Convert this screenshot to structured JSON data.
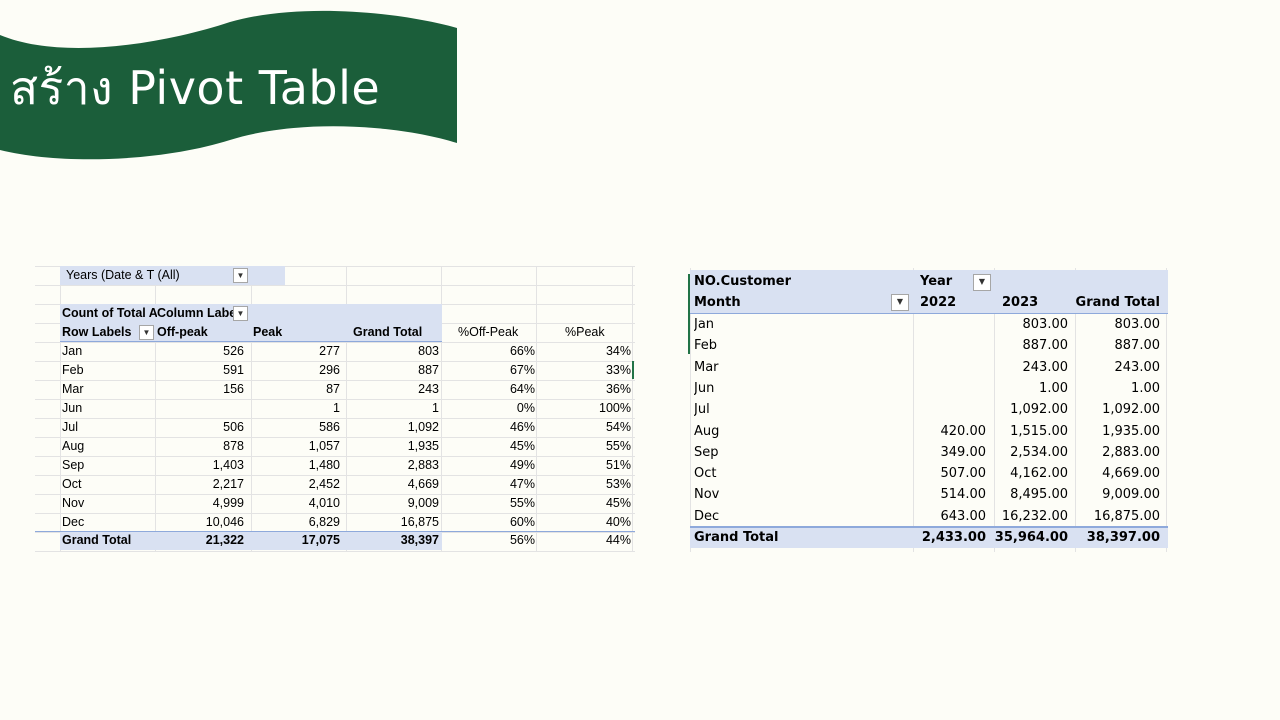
{
  "title": "สร้าง Pivot Table",
  "colors": {
    "banner": "#1b5e3a",
    "pivot_header": "#d9e1f2",
    "pivot_border": "#8ea9db",
    "selected_cell": "#217346"
  },
  "left_pivot": {
    "filter_label": "Years (Date & T (All)",
    "value_field_label": "Count of Total A",
    "column_labels_label": "Column Labe",
    "row_labels_label": "Row Labels",
    "headers": [
      "Off-peak",
      "Peak",
      "Grand Total",
      "%Off-Peak",
      "%Peak"
    ],
    "rows": [
      [
        "Jan",
        "526",
        "277",
        "803",
        "66%",
        "34%"
      ],
      [
        "Feb",
        "591",
        "296",
        "887",
        "67%",
        "33%"
      ],
      [
        "Mar",
        "156",
        "87",
        "243",
        "64%",
        "36%"
      ],
      [
        "Jun",
        "",
        "1",
        "1",
        "0%",
        "100%"
      ],
      [
        "Jul",
        "506",
        "586",
        "1,092",
        "46%",
        "54%"
      ],
      [
        "Aug",
        "878",
        "1,057",
        "1,935",
        "45%",
        "55%"
      ],
      [
        "Sep",
        "1,403",
        "1,480",
        "2,883",
        "49%",
        "51%"
      ],
      [
        "Oct",
        "2,217",
        "2,452",
        "4,669",
        "47%",
        "53%"
      ],
      [
        "Nov",
        "4,999",
        "4,010",
        "9,009",
        "55%",
        "45%"
      ],
      [
        "Dec",
        "10,046",
        "6,829",
        "16,875",
        "60%",
        "40%"
      ]
    ],
    "total": [
      "Grand Total",
      "21,322",
      "17,075",
      "38,397",
      "56%",
      "44%"
    ],
    "dropdown_icon": "filter-dropdown-icon"
  },
  "right_pivot": {
    "value_field_label": "NO.Customer",
    "column_field_label": "Year",
    "row_field_label": "Month",
    "headers": [
      "2022",
      "2023",
      "Grand Total"
    ],
    "rows": [
      [
        "Jan",
        "",
        "803.00",
        "803.00"
      ],
      [
        "Feb",
        "",
        "887.00",
        "887.00"
      ],
      [
        "Mar",
        "",
        "243.00",
        "243.00"
      ],
      [
        "Jun",
        "",
        "1.00",
        "1.00"
      ],
      [
        "Jul",
        "",
        "1,092.00",
        "1,092.00"
      ],
      [
        "Aug",
        "420.00",
        "1,515.00",
        "1,935.00"
      ],
      [
        "Sep",
        "349.00",
        "2,534.00",
        "2,883.00"
      ],
      [
        "Oct",
        "507.00",
        "4,162.00",
        "4,669.00"
      ],
      [
        "Nov",
        "514.00",
        "8,495.00",
        "9,009.00"
      ],
      [
        "Dec",
        "643.00",
        "16,232.00",
        "16,875.00"
      ]
    ],
    "total": [
      "Grand Total",
      "2,433.00",
      "35,964.00",
      "38,397.00"
    ]
  }
}
